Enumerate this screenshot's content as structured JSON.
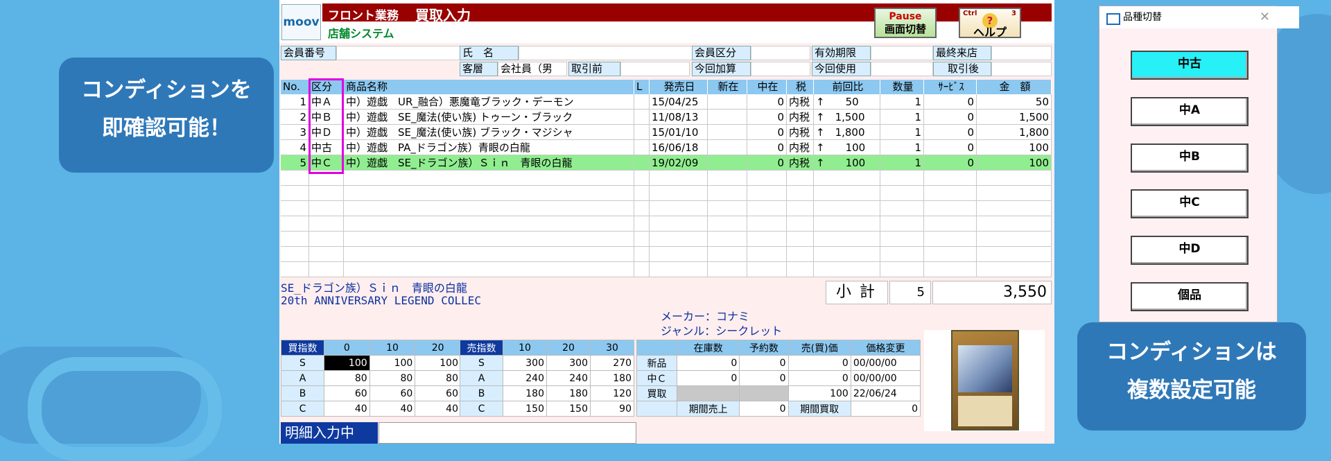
{
  "callout_left": {
    "line1": "コンディションを",
    "line2": "即確認可能！"
  },
  "callout_right": {
    "line1": "コンディションは",
    "line2": "複数設定可能"
  },
  "app": {
    "logo": "moov",
    "module": "フロント業務",
    "screen": "買取入力",
    "subtitle": "店舗システム",
    "pause_top": "Pause",
    "pause_label": "画面切替",
    "help_ctrl": "Ctrl",
    "help_num": "3",
    "help_q": "?",
    "help_label": "ヘルプ"
  },
  "member": {
    "no_label": "会員番号",
    "name_label": "氏　名",
    "class_label": "会員区分",
    "expiry_label": "有効期限",
    "last_visit_label": "最終来店",
    "customer_label": "客層",
    "customer_value": "会社員（男",
    "before_label": "取引前",
    "add_label": "今回加算",
    "use_label": "今回使用",
    "after_label": "取引後"
  },
  "grid": {
    "headers": [
      "No.",
      "区分",
      "商品名称",
      "L",
      "発売日",
      "新在",
      "中在",
      "税",
      "前回比",
      "数量",
      "ｻｰﾋﾞｽ",
      "金　額"
    ],
    "rows": [
      {
        "no": "1",
        "cat": "中Ａ",
        "name": "中）遊戯　UR_融合）悪魔竜ブラック・デーモン",
        "date": "15/04/25",
        "new": "",
        "used": "0",
        "tax": "内税",
        "prev": "↑　　50",
        "qty": "1",
        "svc": "0",
        "amt": "50"
      },
      {
        "no": "2",
        "cat": "中Ｂ",
        "name": "中）遊戯　SE_魔法(使い族) トゥーン・ブラック",
        "date": "11/08/13",
        "new": "",
        "used": "0",
        "tax": "内税",
        "prev": "↑　1,500",
        "qty": "1",
        "svc": "0",
        "amt": "1,500"
      },
      {
        "no": "3",
        "cat": "中Ｄ",
        "name": "中）遊戯　SE_魔法(使い族) ブラック・マジシャ",
        "date": "15/01/10",
        "new": "",
        "used": "0",
        "tax": "内税",
        "prev": "↑　1,800",
        "qty": "1",
        "svc": "0",
        "amt": "1,800"
      },
      {
        "no": "4",
        "cat": "中古",
        "name": "中）遊戯　PA_ドラゴン族）青眼の白龍",
        "date": "16/06/18",
        "new": "",
        "used": "0",
        "tax": "内税",
        "prev": "↑　　100",
        "qty": "1",
        "svc": "0",
        "amt": "100"
      },
      {
        "no": "5",
        "cat": "中Ｃ",
        "name": "中）遊戯　SE_ドラゴン族）Ｓｉｎ　青眼の白龍",
        "date": "19/02/09",
        "new": "",
        "used": "0",
        "tax": "内税",
        "prev": "↑　　100",
        "qty": "1",
        "svc": "0",
        "amt": "100"
      }
    ]
  },
  "detail": {
    "line1": "SE_ドラゴン族）Ｓｉｎ　青眼の白龍",
    "line2": "20th ANNIVERSARY LEGEND COLLEC",
    "maker": "メーカー：コナミ",
    "genre": "ジャンル：シークレット"
  },
  "subtotal": {
    "label": "小計",
    "count": "5",
    "amount": "3,550"
  },
  "buy_index": {
    "title": "買指数",
    "cols": [
      "0",
      "10",
      "20"
    ],
    "rows": [
      {
        "grade": "S",
        "v": [
          "100",
          "100",
          "100"
        ]
      },
      {
        "grade": "A",
        "v": [
          "80",
          "80",
          "80"
        ]
      },
      {
        "grade": "B",
        "v": [
          "60",
          "60",
          "60"
        ]
      },
      {
        "grade": "C",
        "v": [
          "40",
          "40",
          "40"
        ]
      }
    ]
  },
  "sell_index": {
    "title": "売指数",
    "cols": [
      "10",
      "20",
      "30"
    ],
    "rows": [
      {
        "grade": "S",
        "v": [
          "300",
          "300",
          "270"
        ]
      },
      {
        "grade": "A",
        "v": [
          "240",
          "240",
          "180"
        ]
      },
      {
        "grade": "B",
        "v": [
          "180",
          "180",
          "120"
        ]
      },
      {
        "grade": "C",
        "v": [
          "150",
          "150",
          "90"
        ]
      }
    ]
  },
  "stock": {
    "headers": [
      "在庫数",
      "予約数",
      "売(買)価",
      "価格変更"
    ],
    "rows": [
      {
        "label": "新品",
        "v": [
          "0",
          "0",
          "0",
          "00/00/00"
        ]
      },
      {
        "label": "中Ｃ",
        "v": [
          "0",
          "0",
          "0",
          "00/00/00"
        ]
      },
      {
        "label": "買取",
        "v": [
          "",
          "",
          "100",
          "22/06/24"
        ]
      }
    ],
    "period_sales_label": "期間売上",
    "period_sales": "0",
    "period_buy_label": "期間買取",
    "period_buy": "0"
  },
  "status": {
    "label": "明細入力中"
  },
  "dialog": {
    "title": "品種切替",
    "close": "✕",
    "buttons": [
      "中古",
      "中A",
      "中B",
      "中C",
      "中D",
      "個品"
    ]
  }
}
